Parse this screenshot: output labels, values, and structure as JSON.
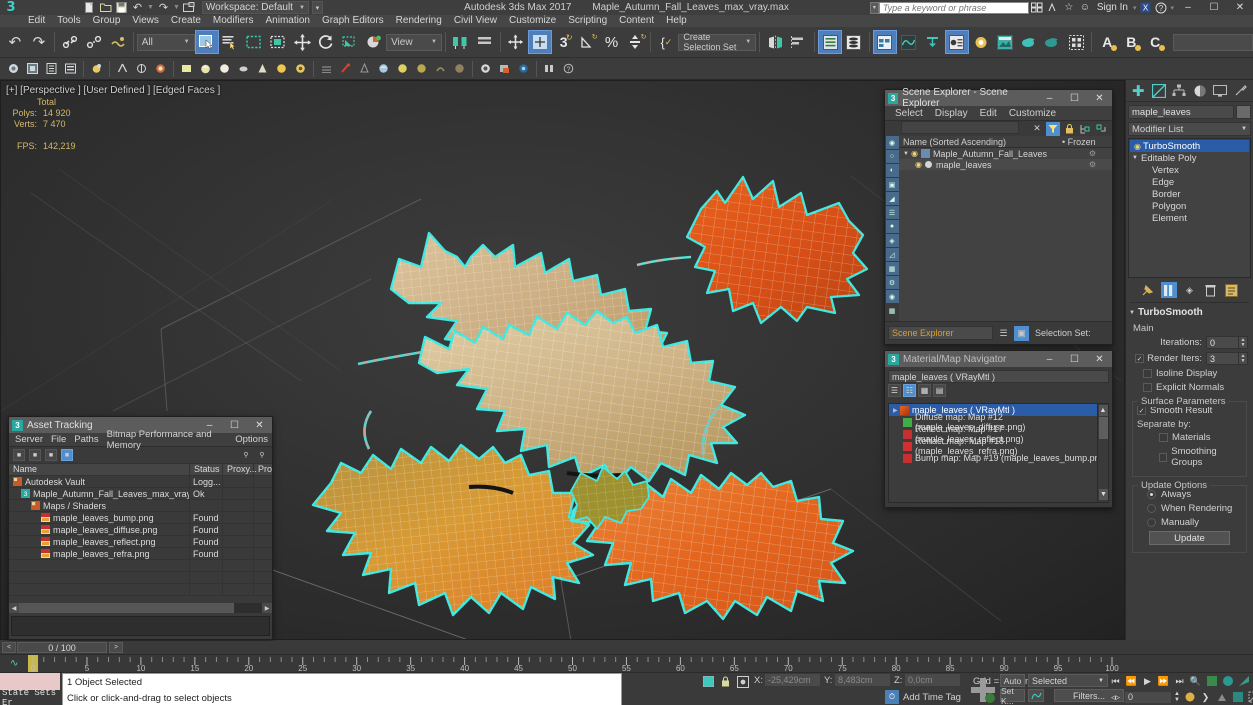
{
  "titlebar": {
    "logo": "3",
    "app_title": "Autodesk 3ds Max 2017",
    "file_name": "Maple_Autumn_Fall_Leaves_max_vray.max",
    "workspace_label": "Workspace: Default",
    "search_placeholder": "Type a keyword or phrase",
    "signin_label": "Sign In",
    "minimize": "–",
    "maximize": "❐",
    "close": "✕",
    "quick_icons": [
      "new-file-icon",
      "open-file-icon",
      "save-file-icon",
      "undo-icon",
      "redo-icon",
      "project-folder-icon"
    ]
  },
  "menubar": {
    "items": [
      "Edit",
      "Tools",
      "Group",
      "Views",
      "Create",
      "Modifiers",
      "Animation",
      "Graph Editors",
      "Rendering",
      "Civil View",
      "Customize",
      "Scripting",
      "Content",
      "Help"
    ]
  },
  "toolbar": {
    "selection_filter": "All",
    "reference_coord": "View",
    "selection_set": "Create Selection Set",
    "icons": [
      "undo-icon",
      "redo-icon",
      "select-link-icon",
      "unlink-icon",
      "bind-spacewarp-icon",
      "select-object-icon",
      "select-by-name-icon",
      "rect-selection-region-icon",
      "window-crossing-icon",
      "select-move-icon",
      "select-rotate-icon",
      "select-scale-icon",
      "placement-icon",
      "snaps-toggle-icon",
      "angle-snap-icon",
      "percent-snap-icon",
      "spinner-snap-icon",
      "named-selection-icon",
      "mirror-icon",
      "align-icon",
      "layer-manager-icon",
      "graphite-modeling-icon",
      "curve-editor-icon",
      "schematic-view-icon",
      "material-editor-icon",
      "render-setup-icon",
      "rendered-frame-icon",
      "render-production-icon",
      "render-iterative-icon",
      "activeshade-icon",
      "project-folder-icon"
    ]
  },
  "vray_toolbar": {
    "icons": [
      "vray-light-icon",
      "vray-plane-light-icon",
      "vray-sphere-light-icon",
      "vray-dome-light-icon",
      "vray-sun-icon",
      "vray-ies-icon",
      "vray-ambient-icon",
      "vray-proxy-icon",
      "vray-fur-icon",
      "vray-plane-icon",
      "vray-sphere-icon",
      "vray-mesh-icon",
      "vray-light-mtl-icon",
      "vray-mtl-icon",
      "vray-blend-icon",
      "vray-displacement-icon",
      "vray-clipper-icon",
      "vray-scatter-icon",
      "vray-toon-icon",
      "vray-physical-cam-icon",
      "vray-vfb-icon",
      "vray-render-icon",
      "vray-progressive-icon",
      "vray-gi-icon",
      "vray-lightcache-icon",
      "vray-irradiance-icon",
      "vray-frame-buffer-icon",
      "vray-stereo-icon",
      "vray-help-icon"
    ]
  },
  "viewport": {
    "label": "[+] [Perspective ] [User Defined ] [Edged Faces ]",
    "stats": {
      "total_header": "Total",
      "polys_label": "Polys:",
      "polys_value": "14 920",
      "verts_label": "Verts:",
      "verts_value": "7 470",
      "fps_label": "FPS:",
      "fps_value": "142,219"
    },
    "selection_outline_color": "#3fe8e0",
    "wireframe_color": "#ffffff",
    "leaf_colors": [
      "#d8bc96",
      "#c9a97e",
      "#d09a4c",
      "#e07a30",
      "#e8601f",
      "#b08a3a"
    ],
    "background_color": "#333333"
  },
  "scene_explorer": {
    "window_title": "Scene Explorer - Scene Explorer",
    "menu": [
      "Select",
      "Display",
      "Edit",
      "Customize"
    ],
    "toolbar_icons": [
      "clear-filter-icon",
      "filter-icon",
      "lock-icon",
      "expand-all-icon",
      "collapse-all-icon"
    ],
    "columns": [
      "Name (Sorted Ascending)",
      "Frozen"
    ],
    "rows": [
      {
        "name": "Maple_Autumn_Fall_Leaves",
        "indent": 0,
        "type": "group"
      },
      {
        "name": "maple_leaves",
        "indent": 1,
        "type": "object",
        "selected": true
      }
    ],
    "bottom_field": "Scene Explorer",
    "selection_set_label": "Selection Set:",
    "side_icons": [
      "select-all-icon",
      "select-none-icon",
      "select-invert-icon",
      "display-icon",
      "freeze-icon",
      "hide-icon",
      "object-props-icon",
      "layer-icon",
      "tools-icon",
      "render-icon",
      "container-icon",
      "isolate-icon",
      "eye-icon",
      "column-icon"
    ]
  },
  "material_map_navigator": {
    "window_title": "Material/Map Navigator",
    "material_field": "maple_leaves  ( VRayMtl )",
    "view_icons": [
      "list-view-icon",
      "tree-view-icon",
      "small-icon-view-icon",
      "large-icon-view-icon"
    ],
    "root": "maple_leaves  ( VRayMtl )",
    "maps": [
      {
        "label": "Diffuse map: Map #12 (maple_leaves_diffuse.png)",
        "color": "#3fae46"
      },
      {
        "label": "Reflect map: Map #17 (maple_leaves_reflect.png)",
        "color": "#c83030"
      },
      {
        "label": "Refract map: Map #18 (maple_leaves_refra.png)",
        "color": "#d03030"
      },
      {
        "label": "Bump map: Map #19 (maple_leaves_bump.png)",
        "color": "#c83030"
      }
    ]
  },
  "asset_tracking": {
    "window_title": "Asset Tracking",
    "menu": [
      "Server",
      "File",
      "Paths",
      "Bitmap Performance and Memory",
      "Options"
    ],
    "columns": [
      "Name",
      "Status",
      "Proxy...",
      "Pro"
    ],
    "rows": [
      {
        "name": "Autodesk Vault",
        "status": "Logg...",
        "indent": 0,
        "icon": "vault-icon"
      },
      {
        "name": "Maple_Autumn_Fall_Leaves_max_vray.max",
        "status": "Ok",
        "indent": 1,
        "icon": "max-file-icon"
      },
      {
        "name": "Maps / Shaders",
        "status": "",
        "indent": 2,
        "icon": "folder-icon"
      },
      {
        "name": "maple_leaves_bump.png",
        "status": "Found",
        "indent": 3,
        "icon": "bitmap-icon"
      },
      {
        "name": "maple_leaves_diffuse.png",
        "status": "Found",
        "indent": 3,
        "icon": "bitmap-icon"
      },
      {
        "name": "maple_leaves_reflect.png",
        "status": "Found",
        "indent": 3,
        "icon": "bitmap-icon"
      },
      {
        "name": "maple_leaves_refra.png",
        "status": "Found",
        "indent": 3,
        "icon": "bitmap-icon"
      }
    ]
  },
  "command_panel": {
    "tabs": [
      "create-tab",
      "modify-tab",
      "hierarchy-tab",
      "motion-tab",
      "display-tab",
      "utilities-tab"
    ],
    "active_tab_index": 1,
    "object_name": "maple_leaves",
    "modifier_list_label": "Modifier List",
    "stack": [
      {
        "label": "TurboSmooth",
        "selected": true,
        "has_eye": true
      },
      {
        "label": "Editable Poly",
        "selected": false,
        "expandable": true
      },
      {
        "label": "Vertex",
        "sub": true
      },
      {
        "label": "Edge",
        "sub": true
      },
      {
        "label": "Border",
        "sub": true
      },
      {
        "label": "Polygon",
        "sub": true
      },
      {
        "label": "Element",
        "sub": true
      }
    ],
    "stack_tools": [
      "pin-stack-icon",
      "show-end-result-icon",
      "make-unique-icon",
      "remove-modifier-icon",
      "configure-sets-icon"
    ],
    "rollout": {
      "title": "TurboSmooth",
      "main_group": "Main",
      "iterations_label": "Iterations:",
      "iterations_value": "0",
      "render_iters_label": "Render Iters:",
      "render_iters_value": "3",
      "render_iters_checked": true,
      "isoline_label": "Isoline Display",
      "isoline_checked": false,
      "explicit_normals_label": "Explicit Normals",
      "explicit_normals_checked": false,
      "surface_params_group": "Surface Parameters",
      "smooth_result_label": "Smooth Result",
      "smooth_result_checked": true,
      "separate_by_label": "Separate by:",
      "materials_label": "Materials",
      "materials_checked": false,
      "smoothing_groups_label": "Smoothing Groups",
      "smoothing_groups_checked": false,
      "update_options_group": "Update Options",
      "always_label": "Always",
      "when_rendering_label": "When Rendering",
      "manually_label": "Manually",
      "update_mode": "Always",
      "update_button": "Update"
    }
  },
  "timeline": {
    "frame_display": "0 / 100",
    "prev_label": "<",
    "next_label": ">",
    "ticks": [
      "0",
      "5",
      "10",
      "15",
      "20",
      "25",
      "30",
      "35",
      "40",
      "45",
      "50",
      "55",
      "60",
      "65",
      "70",
      "75",
      "80",
      "85",
      "90",
      "95",
      "100"
    ],
    "current_frame": 0
  },
  "statusbar": {
    "state_sets_label": "State Sets Er",
    "message_line1": "1 Object Selected",
    "message_line2": "Click or click-and-drag to select objects",
    "coords": {
      "x_label": "X:",
      "x_value": "-25,429cm",
      "y_label": "Y:",
      "y_value": "8,483cm",
      "z_label": "Z:",
      "z_value": "0,0cm"
    },
    "grid_label": "Grid = 10,0cm",
    "add_time_tag": "Add Time Tag",
    "auto_key": "Auto",
    "set_key": "Set K...",
    "key_filter_selection": "Selected",
    "filters_label": "Filters...",
    "key_frame_value": "0",
    "transport_icons": [
      "go-to-start-icon",
      "previous-frame-icon",
      "play-animation-icon",
      "next-frame-icon",
      "go-to-end-icon",
      "zoom-icon",
      "pan-icon",
      "orbit-icon",
      "maximize-viewport-icon",
      "key-mode-icon",
      "field-of-view-icon",
      "zoom-extents-icon",
      "zoom-region-icon",
      "walkthrough-icon"
    ]
  }
}
